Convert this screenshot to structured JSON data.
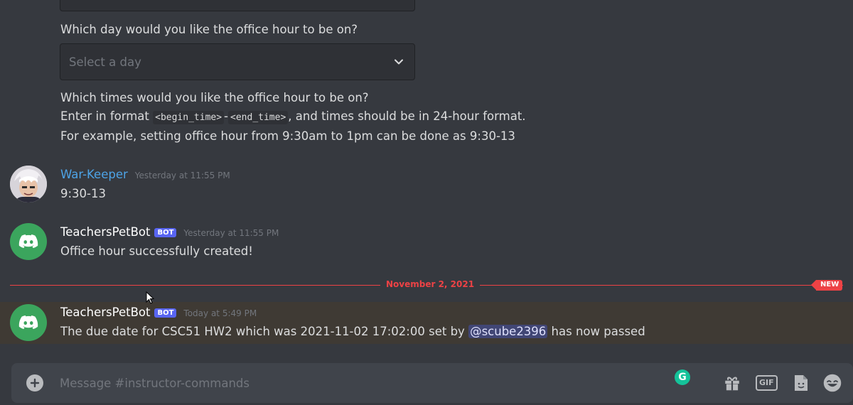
{
  "prompts": {
    "day_question": "Which day would you like the office hour to be on?",
    "day_select_placeholder": "Select a day",
    "time_question": "Which times would you like the office hour to be on?",
    "format_prefix": "Enter in format ",
    "format_code_begin": "<begin_time>",
    "format_code_sep": "-",
    "format_code_end": "<end_time>",
    "format_suffix": ", and times should be in 24-hour format.",
    "example_line": "For example, setting office hour from 9:30am to 1pm can be done as 9:30-13"
  },
  "messages": [
    {
      "author": "War-Keeper",
      "timestamp": "Yesterday at 11:55 PM",
      "content": "9:30-13"
    },
    {
      "author": "TeachersPetBot",
      "badge": "BOT",
      "timestamp": "Yesterday at 11:55 PM",
      "content": "Office hour successfully created!"
    },
    {
      "author": "TeachersPetBot",
      "badge": "BOT",
      "timestamp": "Today at 5:49 PM",
      "content_before": "The due date for CSC51 HW2 which was 2021-11-02 17:02:00 set by ",
      "mention": "@scube2396",
      "content_after": " has now passed"
    }
  ],
  "divider": {
    "date": "November 2, 2021",
    "badge": "NEW"
  },
  "composer": {
    "placeholder": "Message #instructor-commands",
    "gif_label": "GIF",
    "grammarly_label": "G"
  },
  "colors": {
    "background": "#36393f",
    "accent_bot": "#5865f2",
    "new_divider": "#ed4245",
    "username_blue": "#4da3e6",
    "bot_avatar": "#3ba55d"
  }
}
